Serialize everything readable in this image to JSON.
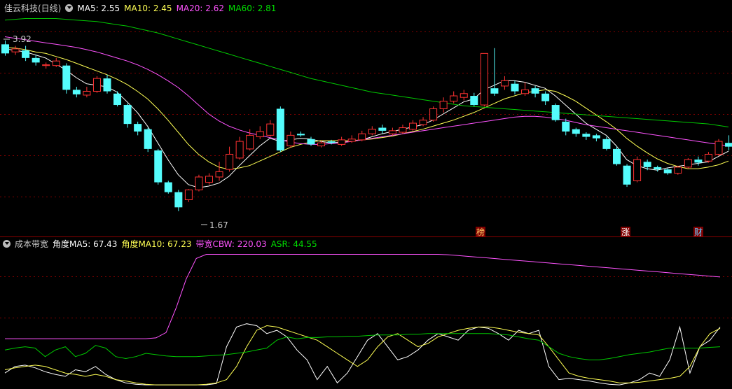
{
  "main_header": {
    "title": "佳云科技(日线)",
    "ma5": "MA5: 2.55",
    "ma10": "MA10: 2.45",
    "ma20": "MA20: 2.62",
    "ma60": "MA60: 2.81"
  },
  "sub_header": {
    "title": "成本带宽",
    "ang5": "角度MA5: 67.43",
    "ang10": "角度MA10: 67.23",
    "cbw": "带宽CBW: 220.03",
    "asr": "ASR: 44.55"
  },
  "annotations": {
    "high": "3.92",
    "low": "1.67"
  },
  "event_labels": [
    "榜",
    "涨",
    "财"
  ],
  "colors": {
    "up": "#ff3232",
    "down": "#54fcfc",
    "ma5": "#ffffff",
    "ma10": "#ffff54",
    "ma20": "#ff54ff",
    "ma60": "#00c800",
    "grid": "#800000",
    "event_bg": "#800000",
    "event_text_1": "#ffcc66",
    "event_text_2": "#ffffff",
    "event_text_3": "#66ccff"
  },
  "chart_data": [
    {
      "type": "candlestick",
      "title": "佳云科技(日线)",
      "ylim": [
        1.55,
        4.3
      ],
      "candles": [
        [
          3.9,
          3.78,
          3.95,
          3.75
        ],
        [
          3.8,
          3.84,
          3.88,
          3.76
        ],
        [
          3.82,
          3.72,
          3.88,
          3.68
        ],
        [
          3.72,
          3.66,
          3.76,
          3.62
        ],
        [
          3.62,
          3.63,
          3.66,
          3.58
        ],
        [
          3.62,
          3.68,
          3.72,
          3.6
        ],
        [
          3.62,
          3.3,
          3.65,
          3.25
        ],
        [
          3.3,
          3.24,
          3.34,
          3.2
        ],
        [
          3.23,
          3.28,
          3.34,
          3.2
        ],
        [
          3.28,
          3.45,
          3.48,
          3.26
        ],
        [
          3.45,
          3.28,
          3.5,
          3.25
        ],
        [
          3.25,
          3.1,
          3.28,
          3.08
        ],
        [
          3.1,
          2.85,
          3.12,
          2.8
        ],
        [
          2.85,
          2.75,
          2.88,
          2.7
        ],
        [
          2.78,
          2.52,
          2.8,
          2.48
        ],
        [
          2.5,
          2.08,
          2.52,
          2.05
        ],
        [
          2.08,
          1.95,
          2.1,
          1.93
        ],
        [
          1.95,
          1.75,
          1.98,
          1.7
        ],
        [
          1.85,
          1.98,
          1.99,
          1.82
        ],
        [
          1.98,
          2.15,
          2.18,
          1.96
        ],
        [
          2.08,
          2.16,
          2.2,
          2.05
        ],
        [
          2.15,
          2.22,
          2.35,
          2.1
        ],
        [
          2.25,
          2.45,
          2.55,
          2.22
        ],
        [
          2.4,
          2.62,
          2.68,
          2.38
        ],
        [
          2.52,
          2.7,
          2.78,
          2.5
        ],
        [
          2.68,
          2.75,
          2.82,
          2.65
        ],
        [
          2.7,
          2.85,
          2.9,
          2.68
        ],
        [
          3.05,
          2.5,
          3.08,
          2.48
        ],
        [
          2.56,
          2.7,
          2.75,
          2.54
        ],
        [
          2.72,
          2.7,
          2.75,
          2.68
        ],
        [
          2.65,
          2.58,
          2.68,
          2.56
        ],
        [
          2.56,
          2.6,
          2.63,
          2.54
        ],
        [
          2.62,
          2.6,
          2.64,
          2.58
        ],
        [
          2.58,
          2.64,
          2.68,
          2.56
        ],
        [
          2.62,
          2.65,
          2.7,
          2.6
        ],
        [
          2.64,
          2.72,
          2.76,
          2.62
        ],
        [
          2.72,
          2.78,
          2.82,
          2.7
        ],
        [
          2.8,
          2.76,
          2.84,
          2.72
        ],
        [
          2.72,
          2.76,
          2.8,
          2.7
        ],
        [
          2.74,
          2.8,
          2.84,
          2.72
        ],
        [
          2.78,
          2.86,
          2.9,
          2.76
        ],
        [
          2.84,
          2.9,
          2.94,
          2.82
        ],
        [
          2.9,
          3.05,
          3.08,
          2.88
        ],
        [
          3.05,
          3.15,
          3.2,
          3.0
        ],
        [
          3.15,
          3.22,
          3.28,
          3.12
        ],
        [
          3.2,
          3.25,
          3.3,
          3.16
        ],
        [
          3.22,
          3.1,
          3.26,
          3.08
        ],
        [
          3.1,
          3.78,
          3.78,
          3.08
        ],
        [
          3.32,
          3.25,
          3.85,
          3.22
        ],
        [
          3.35,
          3.42,
          3.48,
          3.3
        ],
        [
          3.38,
          3.28,
          3.42,
          3.24
        ],
        [
          3.25,
          3.3,
          3.4,
          3.22
        ],
        [
          3.32,
          3.25,
          3.35,
          3.2
        ],
        [
          3.25,
          3.15,
          3.28,
          3.1
        ],
        [
          3.1,
          2.9,
          3.12,
          2.88
        ],
        [
          2.88,
          2.75,
          2.92,
          2.7
        ],
        [
          2.78,
          2.72,
          2.8,
          2.68
        ],
        [
          2.72,
          2.68,
          2.74,
          2.64
        ],
        [
          2.7,
          2.66,
          2.72,
          2.62
        ],
        [
          2.65,
          2.52,
          2.68,
          2.5
        ],
        [
          2.52,
          2.32,
          2.55,
          2.3
        ],
        [
          2.3,
          2.05,
          2.32,
          2.02
        ],
        [
          2.1,
          2.38,
          2.42,
          2.08
        ],
        [
          2.35,
          2.28,
          2.38,
          2.24
        ],
        [
          2.28,
          2.25,
          2.3,
          2.22
        ],
        [
          2.25,
          2.2,
          2.27,
          2.18
        ],
        [
          2.2,
          2.28,
          2.3,
          2.18
        ],
        [
          2.28,
          2.38,
          2.4,
          2.26
        ],
        [
          2.38,
          2.34,
          2.42,
          2.3
        ],
        [
          2.36,
          2.45,
          2.48,
          2.34
        ],
        [
          2.45,
          2.62,
          2.65,
          2.43
        ],
        [
          2.6,
          2.55,
          2.7,
          2.5
        ]
      ],
      "ma": {
        "MA5": [
          3.84,
          3.82,
          3.8,
          3.76,
          3.72,
          3.64,
          3.56,
          3.46,
          3.38,
          3.36,
          3.34,
          3.27,
          3.14,
          3.0,
          2.82,
          2.6,
          2.38,
          2.18,
          2.05,
          2.01,
          2.03,
          2.07,
          2.16,
          2.3,
          2.43,
          2.56,
          2.66,
          2.62,
          2.64,
          2.66,
          2.65,
          2.62,
          2.6,
          2.61,
          2.62,
          2.64,
          2.68,
          2.72,
          2.75,
          2.78,
          2.81,
          2.84,
          2.9,
          2.98,
          3.06,
          3.14,
          3.18,
          3.3,
          3.36,
          3.42,
          3.42,
          3.4,
          3.36,
          3.32,
          3.22,
          3.1,
          2.98,
          2.86,
          2.78,
          2.7,
          2.56,
          2.38,
          2.3,
          2.26,
          2.24,
          2.27,
          2.29,
          2.31,
          2.33,
          2.35,
          2.42,
          2.49
        ],
        "MA10": [
          3.86,
          3.85,
          3.83,
          3.8,
          3.78,
          3.74,
          3.7,
          3.65,
          3.6,
          3.55,
          3.5,
          3.44,
          3.37,
          3.28,
          3.18,
          3.05,
          2.9,
          2.74,
          2.58,
          2.45,
          2.35,
          2.28,
          2.25,
          2.27,
          2.3,
          2.36,
          2.42,
          2.48,
          2.54,
          2.58,
          2.61,
          2.63,
          2.63,
          2.63,
          2.63,
          2.64,
          2.65,
          2.67,
          2.69,
          2.72,
          2.75,
          2.78,
          2.82,
          2.86,
          2.9,
          2.95,
          3.0,
          3.06,
          3.12,
          3.18,
          3.22,
          3.26,
          3.28,
          3.3,
          3.28,
          3.22,
          3.15,
          3.06,
          2.97,
          2.88,
          2.78,
          2.66,
          2.56,
          2.47,
          2.39,
          2.33,
          2.29,
          2.26,
          2.26,
          2.28,
          2.31,
          2.36
        ],
        "MA20": [
          4.0,
          3.98,
          3.96,
          3.94,
          3.92,
          3.9,
          3.88,
          3.86,
          3.83,
          3.8,
          3.76,
          3.72,
          3.68,
          3.63,
          3.57,
          3.5,
          3.42,
          3.33,
          3.22,
          3.1,
          2.98,
          2.89,
          2.82,
          2.77,
          2.73,
          2.7,
          2.67,
          2.64,
          2.61,
          2.59,
          2.58,
          2.58,
          2.59,
          2.6,
          2.62,
          2.64,
          2.66,
          2.68,
          2.7,
          2.72,
          2.74,
          2.76,
          2.78,
          2.8,
          2.82,
          2.84,
          2.86,
          2.88,
          2.9,
          2.92,
          2.94,
          2.95,
          2.95,
          2.94,
          2.92,
          2.9,
          2.87,
          2.84,
          2.82,
          2.8,
          2.78,
          2.76,
          2.74,
          2.72,
          2.7,
          2.68,
          2.66,
          2.64,
          2.62,
          2.6,
          2.58,
          2.56
        ],
        "MA60": [
          4.22,
          4.23,
          4.24,
          4.24,
          4.24,
          4.24,
          4.23,
          4.22,
          4.21,
          4.2,
          4.18,
          4.16,
          4.14,
          4.11,
          4.08,
          4.05,
          4.01,
          3.97,
          3.93,
          3.89,
          3.85,
          3.81,
          3.77,
          3.73,
          3.69,
          3.65,
          3.61,
          3.57,
          3.53,
          3.49,
          3.45,
          3.42,
          3.39,
          3.36,
          3.33,
          3.3,
          3.27,
          3.25,
          3.23,
          3.21,
          3.19,
          3.17,
          3.15,
          3.13,
          3.11,
          3.09,
          3.08,
          3.07,
          3.06,
          3.05,
          3.04,
          3.03,
          3.02,
          3.01,
          3.0,
          2.99,
          2.98,
          2.97,
          2.96,
          2.95,
          2.94,
          2.93,
          2.92,
          2.91,
          2.9,
          2.89,
          2.88,
          2.87,
          2.86,
          2.85,
          2.83,
          2.81
        ]
      }
    },
    {
      "type": "line",
      "title": "成本带宽",
      "ylim": [
        0,
        340
      ],
      "series": [
        {
          "name": "带宽CBW",
          "color": "#ff54ff",
          "values": [
            95,
            95,
            95,
            95,
            95,
            95,
            95,
            95,
            95,
            95,
            95,
            95,
            95,
            95,
            95,
            97,
            110,
            170,
            240,
            290,
            300,
            300,
            300,
            300,
            300,
            300,
            300,
            300,
            300,
            300,
            300,
            300,
            300,
            300,
            300,
            300,
            300,
            300,
            300,
            300,
            300,
            300,
            300,
            300,
            299,
            297,
            295,
            293,
            291,
            289,
            287,
            285,
            283,
            281,
            279,
            277,
            275,
            273,
            271,
            269,
            267,
            265,
            263,
            261,
            259,
            257,
            255,
            253,
            251,
            249,
            247,
            245
          ]
        }
      ]
    },
    {
      "type": "line",
      "ylim": [
        0,
        100
      ],
      "series": [
        {
          "name": "角度MA5",
          "color": "#ffffff",
          "values": [
            20,
            30,
            32,
            28,
            22,
            18,
            15,
            25,
            22,
            30,
            18,
            10,
            5,
            3,
            2,
            2,
            2,
            2,
            2,
            2,
            2,
            4,
            60,
            90,
            95,
            92,
            80,
            85,
            75,
            55,
            40,
            10,
            30,
            5,
            20,
            45,
            70,
            80,
            60,
            40,
            45,
            55,
            70,
            80,
            75,
            70,
            85,
            90,
            88,
            80,
            70,
            85,
            80,
            85,
            30,
            10,
            12,
            10,
            8,
            5,
            3,
            2,
            5,
            10,
            20,
            15,
            40,
            90,
            20,
            60,
            70,
            90
          ]
        },
        {
          "name": "角度MA10",
          "color": "#ffff54",
          "values": [
            25,
            28,
            30,
            32,
            30,
            25,
            20,
            18,
            15,
            18,
            15,
            10,
            8,
            5,
            3,
            2,
            2,
            2,
            2,
            2,
            3,
            5,
            10,
            30,
            60,
            85,
            92,
            90,
            85,
            80,
            75,
            70,
            60,
            50,
            40,
            30,
            40,
            60,
            75,
            80,
            70,
            60,
            65,
            75,
            80,
            85,
            88,
            90,
            90,
            88,
            85,
            82,
            80,
            78,
            60,
            40,
            20,
            15,
            12,
            10,
            8,
            5,
            5,
            6,
            8,
            10,
            12,
            15,
            30,
            60,
            80,
            88
          ]
        },
        {
          "name": "ASR",
          "color": "#00c800",
          "values": [
            55,
            58,
            60,
            58,
            45,
            55,
            60,
            45,
            50,
            62,
            58,
            45,
            42,
            45,
            50,
            48,
            46,
            45,
            45,
            45,
            46,
            47,
            48,
            50,
            52,
            55,
            58,
            70,
            75,
            72,
            74,
            74,
            75,
            75,
            76,
            76,
            77,
            78,
            78,
            78,
            79,
            79,
            80,
            80,
            80,
            80,
            80,
            80,
            80,
            79,
            78,
            75,
            72,
            70,
            60,
            50,
            45,
            42,
            40,
            40,
            42,
            45,
            48,
            50,
            52,
            55,
            58,
            58,
            58,
            58,
            59,
            60
          ]
        }
      ]
    }
  ]
}
